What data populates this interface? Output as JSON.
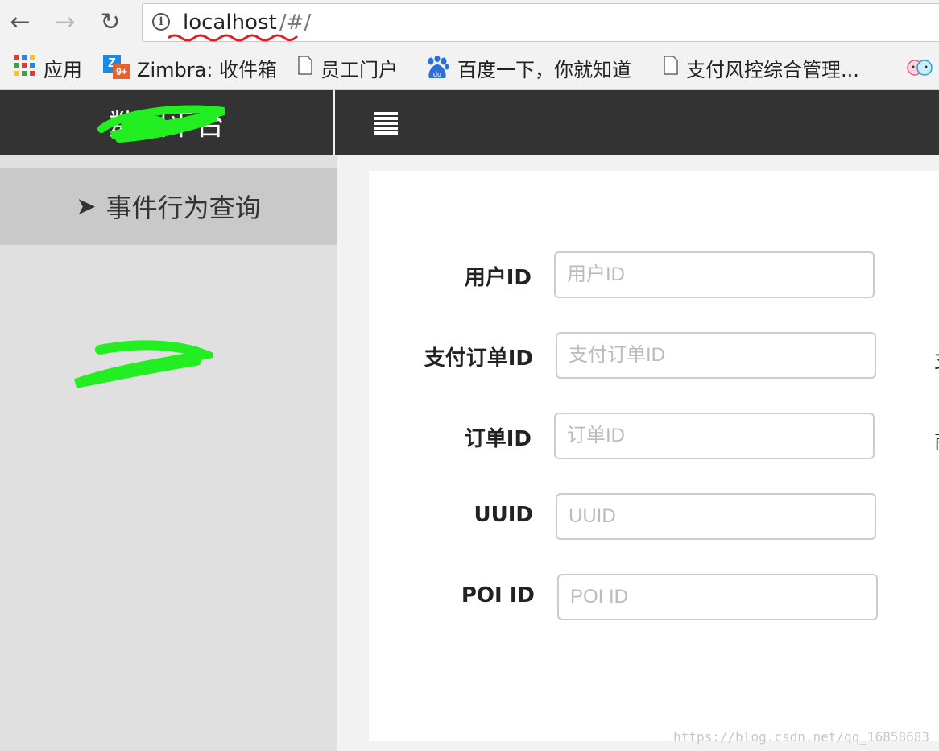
{
  "browser": {
    "url_host": "localhost",
    "url_path": "/#/",
    "bookmarks": [
      {
        "label": "应用",
        "icon": "apps-grid-icon"
      },
      {
        "label": "Zimbra: 收件箱",
        "icon": "zimbra-icon",
        "badge": "9+"
      },
      {
        "label": "员工门户",
        "icon": "page-icon"
      },
      {
        "label": "百度一下，你就知道",
        "icon": "baidu-icon",
        "icon_text": "du"
      },
      {
        "label": "支付风控综合管理...",
        "icon": "page-icon"
      }
    ]
  },
  "header": {
    "brand": "数据平台"
  },
  "sidebar": {
    "items": [
      {
        "label": "事件行为查询",
        "icon": "send-arrow-icon"
      }
    ]
  },
  "form": {
    "fields": [
      {
        "label": "用户ID",
        "placeholder": "用户ID"
      },
      {
        "label": "支付订单ID",
        "placeholder": "支付订单ID"
      },
      {
        "label": "订单ID",
        "placeholder": "订单ID"
      },
      {
        "label": "UUID",
        "placeholder": "UUID"
      },
      {
        "label": "POI ID",
        "placeholder": "POI ID"
      }
    ],
    "edge_glyphs": [
      "支",
      "商"
    ]
  },
  "watermark": "https://blog.csdn.net/qq_16858683",
  "colors": {
    "header_bg": "#333333",
    "sidebar_bg": "#e0e0e0",
    "sidebar_active_bg": "#c9c9c9",
    "redaction_green": "#22ee22"
  }
}
